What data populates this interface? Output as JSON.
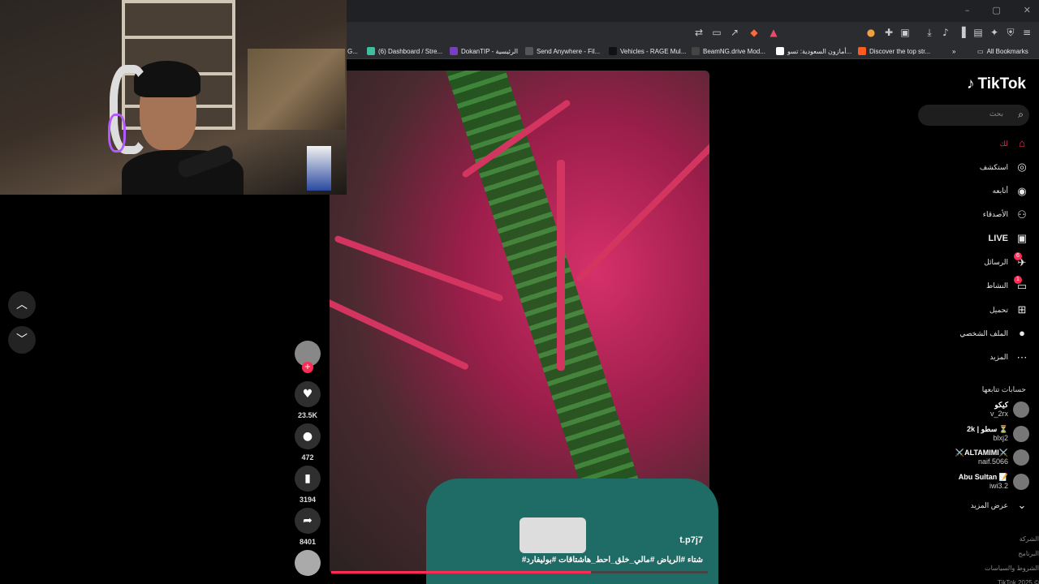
{
  "window": {
    "minimize": "–",
    "maximize": "▢",
    "close": "✕"
  },
  "toolbar": {
    "badge1": "6",
    "badge2": "2"
  },
  "bookmarks": [
    {
      "label": "(6) Dashboard / Stre...",
      "color": "#3fbf9f"
    },
    {
      "label": "DokanTIP - الرئيسية",
      "color": "#7a3fbf"
    },
    {
      "label": "Send Anywhere - Fil...",
      "color": "#555555"
    },
    {
      "label": "Vehicles - RAGE Mul...",
      "color": "#111111"
    },
    {
      "label": "BeamNG.drive Mod...",
      "color": "#444444"
    },
    {
      "label": "أمازون السعودية: تسو...",
      "color": "#ffffff"
    },
    {
      "label": "Discover the top str...",
      "color": "#ff5a1f"
    }
  ],
  "bookmarks_more": "»",
  "all_bookmarks": "All Bookmarks",
  "bookmark_prefix": "G...",
  "video": {
    "username": "t.p7j7",
    "caption": "#شتاء #الرياض #مالي_خلق_احط_هاشتاقات #بوليفارد",
    "progress": 0.69
  },
  "actions": {
    "likes": "23.5K",
    "comments": "472",
    "saves": "3194",
    "shares": "8401"
  },
  "sidebar": {
    "logo": "TikTok",
    "search_placeholder": "بحث",
    "menu": [
      {
        "label": "لك",
        "icon": "home-icon"
      },
      {
        "label": "استكشف",
        "icon": "compass-icon"
      },
      {
        "label": "أتابعه",
        "icon": "following-icon"
      },
      {
        "label": "الأصدقاء",
        "icon": "friends-icon"
      },
      {
        "label": "LIVE",
        "icon": "live-icon"
      },
      {
        "label": "الرسائل",
        "icon": "messages-icon",
        "badge": "6"
      },
      {
        "label": "النشاط",
        "icon": "activity-icon",
        "badge": "1"
      },
      {
        "label": "تحميل",
        "icon": "upload-icon"
      },
      {
        "label": "الملف الشخصي",
        "icon": "profile-icon"
      },
      {
        "label": "المزيد",
        "icon": "more-icon"
      }
    ],
    "following_title": "حسابات تتابعها",
    "following": [
      {
        "name": "كيكو",
        "handle": "v_2rx"
      },
      {
        "name": "2k | سطو ⏳",
        "handle": "blxj2"
      },
      {
        "name": "⚔️ALTAMIMI⚔️",
        "handle": "naif.5066"
      },
      {
        "name": "Abu Sultan 📝",
        "handle": "iwi3.2"
      }
    ],
    "see_more": "عرض المزيد",
    "footer": [
      "الشركة",
      "البرنامج",
      "الشروط والسياسات",
      "TikTok 2025 ©"
    ]
  }
}
